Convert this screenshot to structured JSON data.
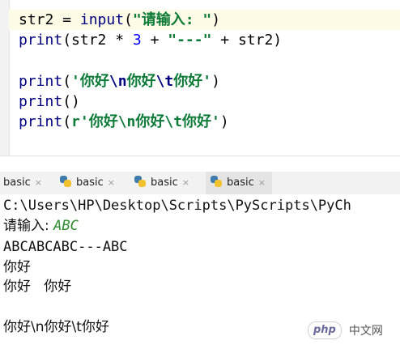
{
  "editor": {
    "line1": {
      "var": "str2 = ",
      "fn": "input",
      "open": "(",
      "str": "\"请输入: \"",
      "close": ")"
    },
    "line2": {
      "fn": "print",
      "a": "(str2 * ",
      "num": "3",
      "b": " + ",
      "str": "\"---\"",
      "c": " + str2)"
    },
    "line4": {
      "fn": "print",
      "open": "(",
      "q1": "'",
      "t1": "你好",
      "e1": "\\n",
      "t2": "你好",
      "e2": "\\t",
      "t3": "你好",
      "q2": "'",
      "close": ")"
    },
    "line5": {
      "fn": "print",
      "args": "()"
    },
    "line6": {
      "fn": "print",
      "open": "(",
      "str": "r'你好\\n你好\\t你好'",
      "close": ")"
    }
  },
  "run_tabs": [
    {
      "label": "basic",
      "close": "×"
    },
    {
      "label": "basic",
      "close": "×"
    },
    {
      "label": "basic",
      "close": "×"
    },
    {
      "label": "basic",
      "close": "×"
    }
  ],
  "console": {
    "path": "C:\\Users\\HP\\Desktop\\Scripts\\PyScripts\\PyCh",
    "prompt": "请输入: ",
    "user_input": "ABC",
    "output1": "ABCABCABC---ABC",
    "output2": "你好",
    "output3": "你好   你好",
    "output5": "你好\\n你好\\t你好"
  },
  "watermark": {
    "logo": "php",
    "text": "中文网"
  },
  "colors": {
    "string": "#0e7b39",
    "function": "#000080",
    "number": "#0000ff",
    "escape": "#000080",
    "user_input": "#2e8b2e"
  }
}
